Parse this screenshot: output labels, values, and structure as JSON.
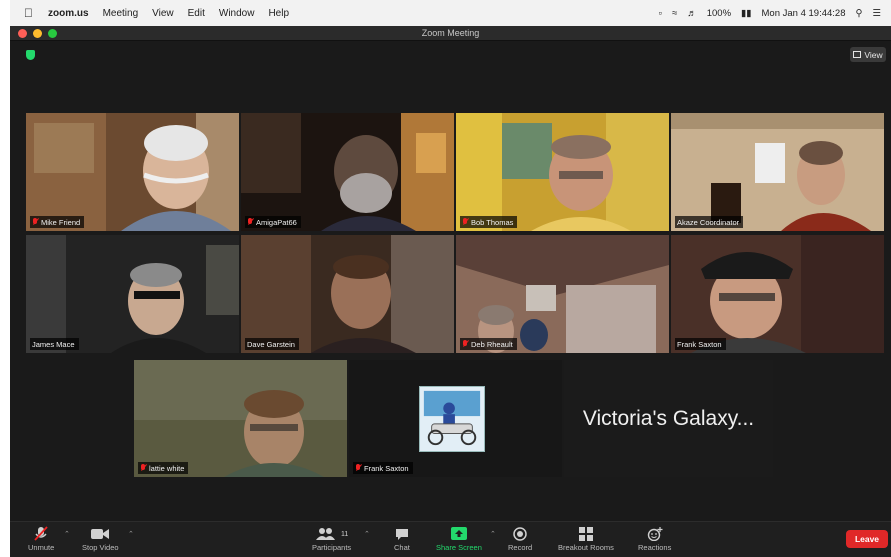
{
  "menubar": {
    "app_name": "zoom.us",
    "items": [
      "Meeting",
      "View",
      "Edit",
      "Window",
      "Help"
    ],
    "battery": "100%",
    "datetime": "Mon Jan 4  19:44:28"
  },
  "window": {
    "title": "Zoom Meeting",
    "view_label": "View"
  },
  "participants": [
    {
      "name": "Mike Friend",
      "muted": true
    },
    {
      "name": "AmigaPat66",
      "muted": true
    },
    {
      "name": "Bob Thomas",
      "muted": true
    },
    {
      "name": "Akaze Coordinator",
      "muted": false
    },
    {
      "name": "James Mace",
      "muted": false,
      "active_speaker": true
    },
    {
      "name": "Dave Garstein",
      "muted": false
    },
    {
      "name": "Deb Rheault",
      "muted": true
    },
    {
      "name": "Frank Saxton",
      "muted": false
    },
    {
      "name": "lattie white",
      "muted": true
    },
    {
      "name": "Frank Saxton",
      "muted": true
    },
    {
      "name": "Victoria's Galaxy...",
      "muted": false,
      "video_off": true
    }
  ],
  "toolbar": {
    "unmute": "Unmute",
    "stop_video": "Stop Video",
    "participants": "Participants",
    "participants_count": "11",
    "chat": "Chat",
    "share_screen": "Share Screen",
    "record": "Record",
    "breakout_rooms": "Breakout Rooms",
    "reactions": "Reactions",
    "leave": "Leave"
  },
  "colors": {
    "active_speaker_border": "#c8e34a",
    "share_green": "#23d96c",
    "leave_red": "#e02828",
    "mute_red": "#e22222"
  }
}
